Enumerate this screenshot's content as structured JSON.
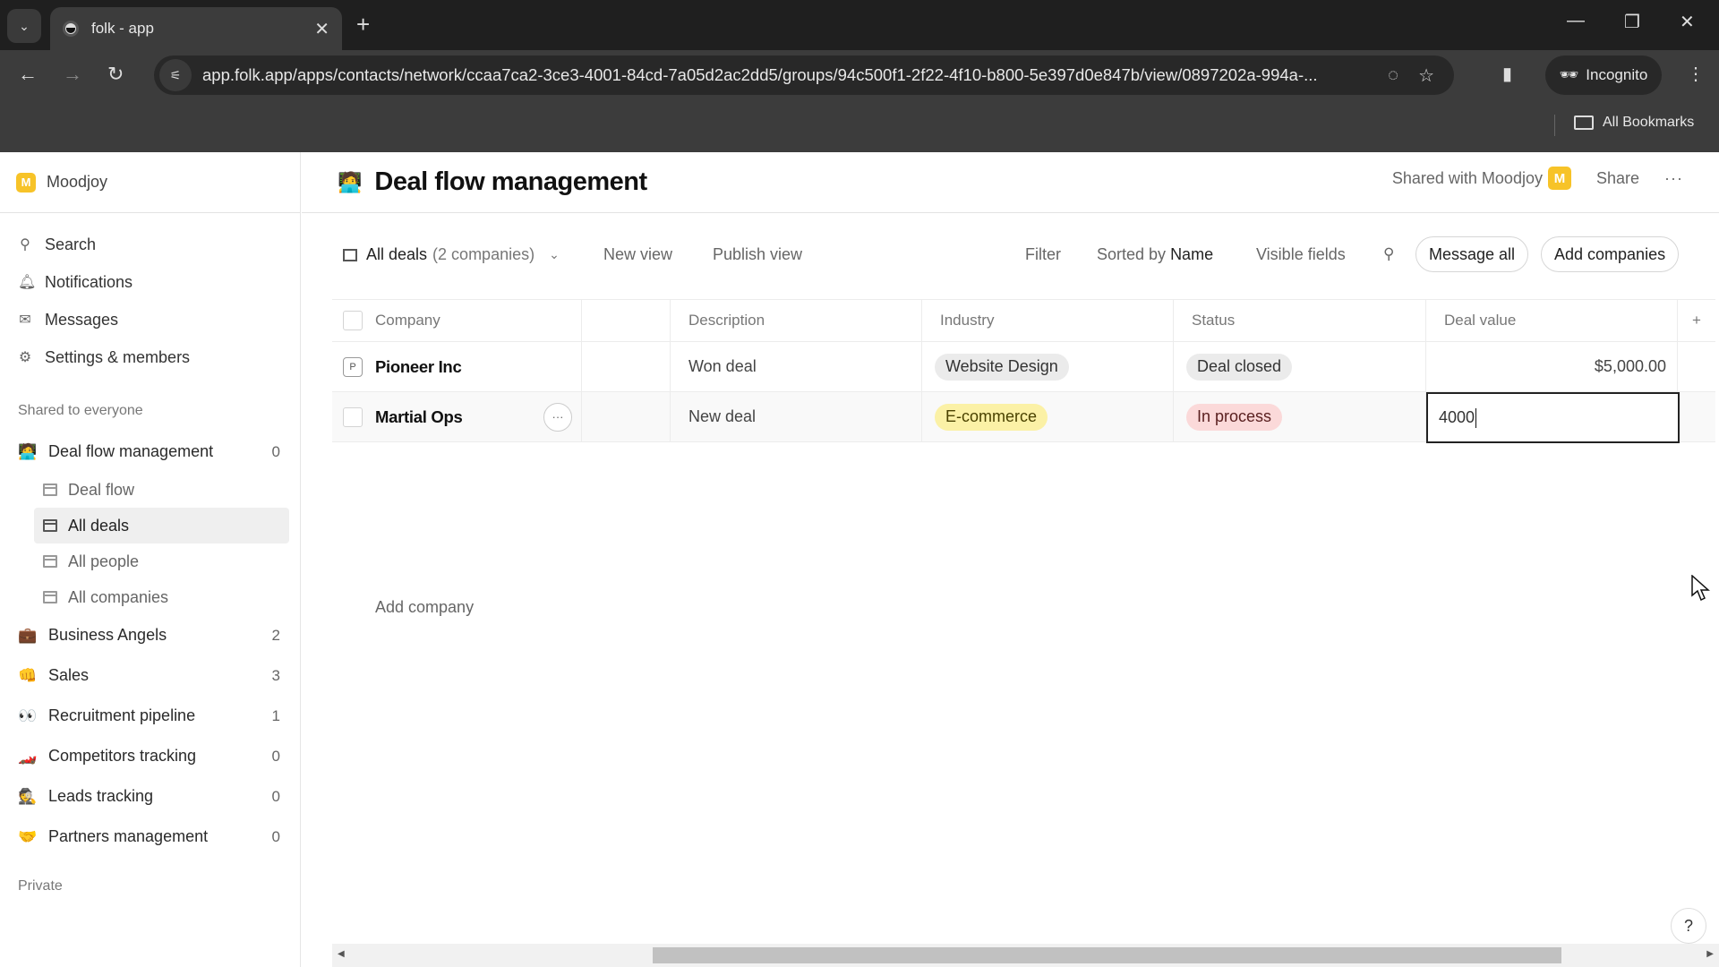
{
  "browser": {
    "tab_title": "folk - app",
    "url": "app.folk.app/apps/contacts/network/ccaa7ca2-3ce3-4001-84cd-7a05d2ac2dd5/groups/94c500f1-2f22-4f10-b800-5e397d0e847b/view/0897202a-994a-...",
    "profile_label": "Incognito",
    "bookmarks_label": "All Bookmarks"
  },
  "workspace": {
    "name": "Moodjoy",
    "initial": "M",
    "color": "#f7c328"
  },
  "sidebar": {
    "nav": [
      {
        "label": "Search",
        "icon": "search-icon"
      },
      {
        "label": "Notifications",
        "icon": "bell-icon"
      },
      {
        "label": "Messages",
        "icon": "mail-icon"
      },
      {
        "label": "Settings & members",
        "icon": "gear-icon"
      }
    ],
    "shared_label": "Shared to everyone",
    "groups": [
      {
        "emoji": "🧑‍💻",
        "label": "Deal flow management",
        "count": "0",
        "views": [
          {
            "label": "Deal flow",
            "icon": "kanban-icon"
          },
          {
            "label": "All deals",
            "icon": "table-icon",
            "active": true
          },
          {
            "label": "All people",
            "icon": "table-icon"
          },
          {
            "label": "All companies",
            "icon": "table-icon"
          }
        ]
      },
      {
        "emoji": "💼",
        "label": "Business Angels",
        "count": "2"
      },
      {
        "emoji": "👊",
        "label": "Sales",
        "count": "3"
      },
      {
        "emoji": "👀",
        "label": "Recruitment pipeline",
        "count": "1"
      },
      {
        "emoji": "🏎️",
        "label": "Competitors tracking",
        "count": "0"
      },
      {
        "emoji": "🕵️",
        "label": "Leads tracking",
        "count": "0"
      },
      {
        "emoji": "🤝",
        "label": "Partners management",
        "count": "0"
      }
    ],
    "private_label": "Private"
  },
  "header": {
    "emoji": "🧑‍💻",
    "title": "Deal flow management",
    "shared_with": "Shared with Moodjoy",
    "share_label": "Share",
    "more_label": "···"
  },
  "viewbar": {
    "view_name": "All deals",
    "view_count": "(2 companies)",
    "new_view": "New view",
    "publish_view": "Publish view",
    "filter": "Filter",
    "sorted_prefix": "Sorted by",
    "sorted_field": "Name",
    "visible_fields": "Visible fields",
    "message_all": "Message all",
    "add_companies": "Add companies"
  },
  "table": {
    "columns": [
      "Company",
      "",
      "Description",
      "Industry",
      "Status",
      "Deal value"
    ],
    "rows": [
      {
        "badge": "P",
        "company": "Pioneer Inc",
        "description": "Won deal",
        "industry": {
          "label": "Website Design",
          "bg": "#ebebeb",
          "fg": "#333333"
        },
        "status": {
          "label": "Deal closed",
          "bg": "#ebebeb",
          "fg": "#333333"
        },
        "deal_value": "$5,000.00"
      },
      {
        "badge": "",
        "company": "Martial Ops",
        "description": "New deal",
        "industry": {
          "label": "E-commerce",
          "bg": "#fbf1a6",
          "fg": "#4a4200"
        },
        "status": {
          "label": "In process",
          "bg": "#fbd9d9",
          "fg": "#5a2020"
        },
        "deal_value_editing": "4000"
      }
    ],
    "add_row_label": "Add company"
  },
  "help_label": "?"
}
